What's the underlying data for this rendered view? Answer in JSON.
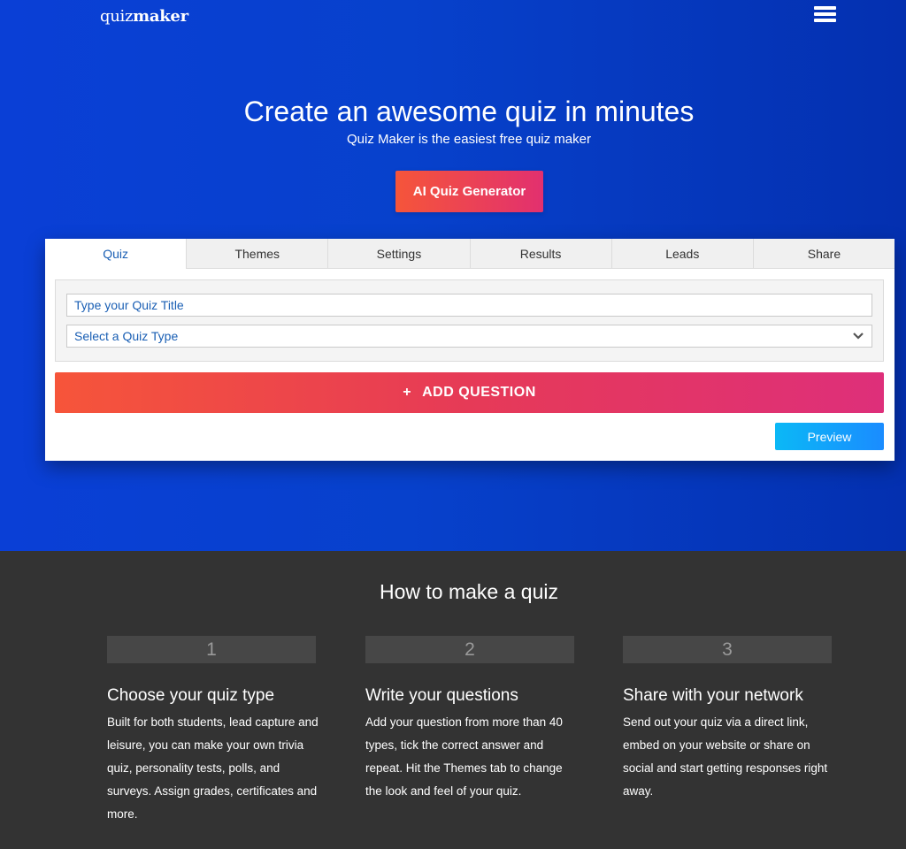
{
  "header": {
    "logo_light": "quiz",
    "logo_bold": "maker",
    "menu_icon": "hamburger-icon"
  },
  "hero": {
    "title": "Create an awesome quiz in minutes",
    "subtitle": "Quiz Maker is the easiest free quiz maker",
    "ai_button": "AI Quiz Generator"
  },
  "editor": {
    "tabs": [
      {
        "label": "Quiz",
        "active": true
      },
      {
        "label": "Themes",
        "active": false
      },
      {
        "label": "Settings",
        "active": false
      },
      {
        "label": "Results",
        "active": false
      },
      {
        "label": "Leads",
        "active": false
      },
      {
        "label": "Share",
        "active": false
      }
    ],
    "title_placeholder": "Type your Quiz Title",
    "title_value": "",
    "quiz_type_selected": "Select a Quiz Type",
    "add_question_plus": "+",
    "add_question_label": "ADD QUESTION",
    "preview_label": "Preview"
  },
  "how_to": {
    "title": "How to make a quiz",
    "steps": [
      {
        "number": "1",
        "title": "Choose your quiz type",
        "description": "Built for both students, lead capture and leisure, you can make your own trivia quiz, personality tests, polls, and surveys. Assign grades, certificates and more."
      },
      {
        "number": "2",
        "title": "Write your questions",
        "description": "Add your question from more than 40 types, tick the correct answer and repeat. Hit the Themes tab to change the look and feel of your quiz."
      },
      {
        "number": "3",
        "title": "Share with your network",
        "description": "Send out your quiz via a direct link, embed on your website or share on social and start getting responses right away."
      }
    ]
  },
  "colors": {
    "hero_blue": "#0741cc",
    "accent_orange": "#f5553a",
    "accent_pink": "#e2306f",
    "preview_blue": "#0bb8f6",
    "dark_section": "#333333"
  }
}
